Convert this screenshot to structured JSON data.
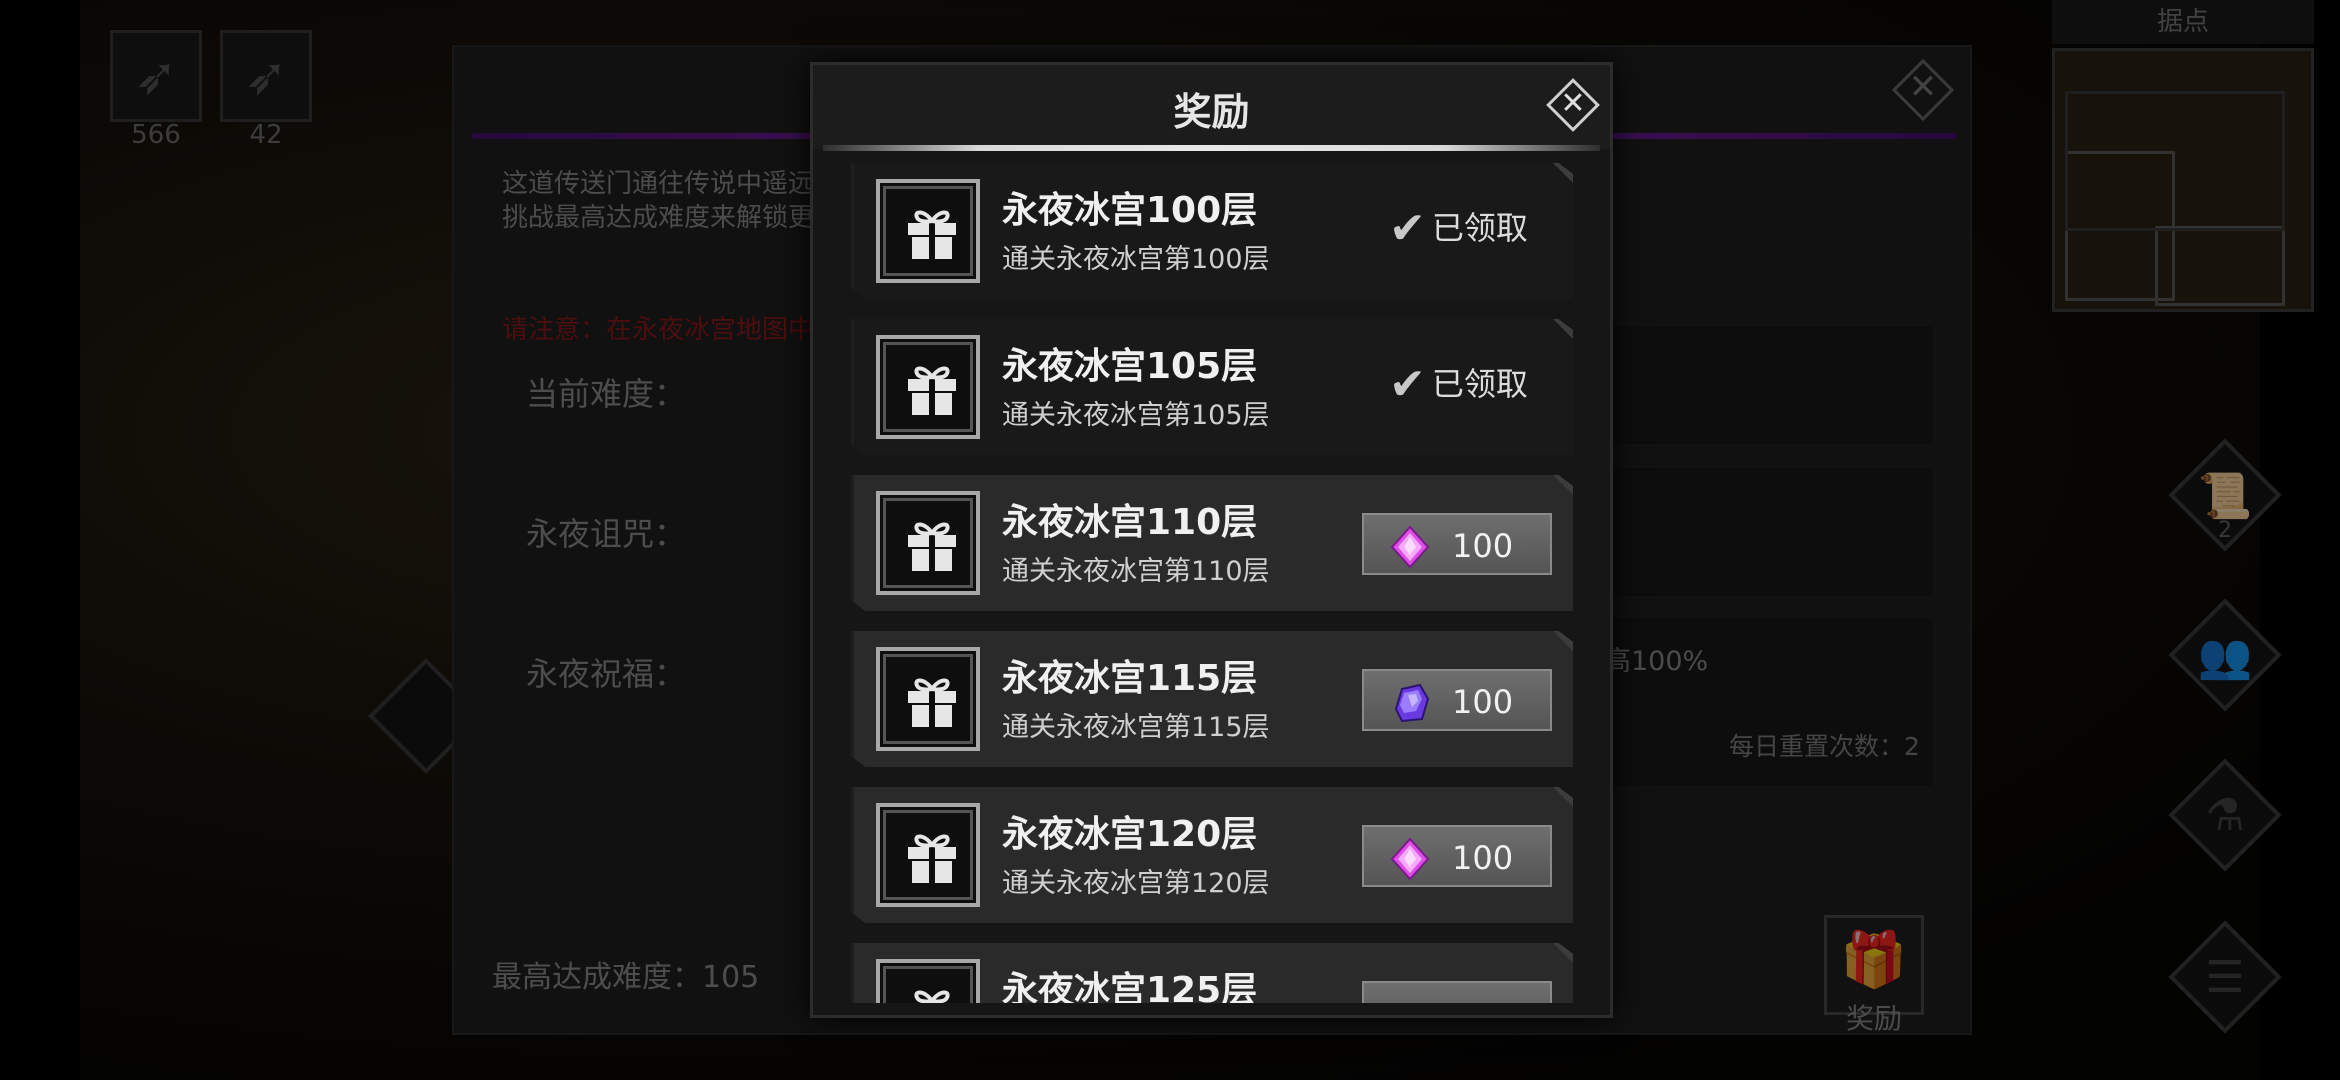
{
  "hud": {
    "skill_counts": [
      "566",
      "42"
    ],
    "minimap_title": "据点",
    "side_badge": "2"
  },
  "portal": {
    "desc_line1": "这道传送门通往传说中遥远的永夜冰宫，勇敢的冒险者，去揭开冰宫深处那永夜的秘密！",
    "desc_line2": "挑战最高达成难度来解锁更多奖励。",
    "warn": "请注意：在永夜冰宫地图中，战斗无次数限制。",
    "label_difficulty": "当前难度：",
    "label_curse": "永夜诅咒：",
    "label_blessing": "永夜祝福：",
    "boost_text": "高100%",
    "daily_reset": "每日重置次数：2",
    "max_difficulty": "最高达成难度：105",
    "reward_button_label": "奖励"
  },
  "modal": {
    "title": "奖励",
    "claimed_label": "已领取",
    "rewards": [
      {
        "name": "永夜冰宫100层",
        "desc": "通关永夜冰宫第100层",
        "claimed": true
      },
      {
        "name": "永夜冰宫105层",
        "desc": "通关永夜冰宫第105层",
        "claimed": true
      },
      {
        "name": "永夜冰宫110层",
        "desc": "通关永夜冰宫第110层",
        "claimed": false,
        "gem": "pink-diamond-icon",
        "amount": "100"
      },
      {
        "name": "永夜冰宫115层",
        "desc": "通关永夜冰宫第115层",
        "claimed": false,
        "gem": "purple-crystal-icon",
        "amount": "100"
      },
      {
        "name": "永夜冰宫120层",
        "desc": "通关永夜冰宫第120层",
        "claimed": false,
        "gem": "pink-diamond-icon",
        "amount": "100"
      },
      {
        "name": "永夜冰宫125层",
        "desc": "",
        "claimed": false,
        "gem": "",
        "amount": ""
      }
    ]
  },
  "colors": {
    "accent_purple": "#8e2ec7",
    "warning_red": "#8a1a1a",
    "gem_pink": "#e04ee8",
    "gem_purple": "#6a3ae0"
  }
}
